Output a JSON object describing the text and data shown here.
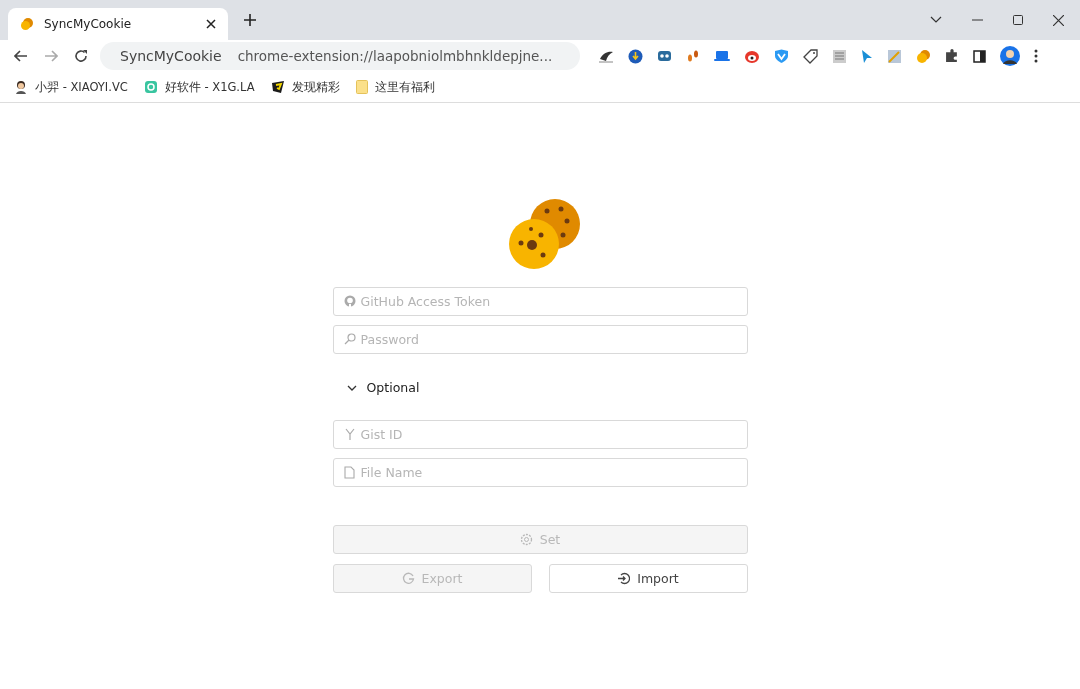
{
  "tab": {
    "title": "SyncMyCookie",
    "selected": true
  },
  "address_bar": {
    "site": "SyncMyCookie",
    "url": "chrome-extension://laapobniolmbhnkldepjne..."
  },
  "bookmarks": [
    {
      "label": "小羿 - XIAOYI.VC"
    },
    {
      "label": "好软件 - X1G.LA"
    },
    {
      "label": "发现精彩"
    },
    {
      "label": "这里有福利"
    }
  ],
  "form": {
    "fields": [
      {
        "placeholder": "GitHub Access Token"
      },
      {
        "placeholder": "Password"
      }
    ],
    "optional": {
      "label": "Optional",
      "expanded": true,
      "fields": [
        {
          "placeholder": "Gist ID"
        },
        {
          "placeholder": "File Name"
        }
      ]
    },
    "set_button": {
      "label": "Set",
      "disabled": true
    },
    "buttons": [
      {
        "label": "Export",
        "disabled": true
      },
      {
        "label": "Import",
        "disabled": false
      }
    ]
  }
}
